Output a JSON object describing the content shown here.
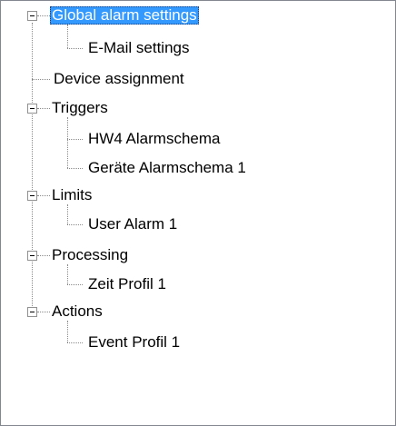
{
  "tree": {
    "nodes": [
      {
        "label": "Global alarm settings",
        "selected": true,
        "expanded": true,
        "children": [
          {
            "label": "E-Mail settings"
          }
        ]
      },
      {
        "label": "Device assignment"
      },
      {
        "label": "Triggers",
        "expanded": true,
        "children": [
          {
            "label": "HW4 Alarmschema"
          },
          {
            "label": "Geräte Alarmschema 1"
          }
        ]
      },
      {
        "label": "Limits",
        "expanded": true,
        "children": [
          {
            "label": "User Alarm 1"
          }
        ]
      },
      {
        "label": "Processing",
        "expanded": true,
        "children": [
          {
            "label": "Zeit Profil 1"
          }
        ]
      },
      {
        "label": "Actions",
        "expanded": true,
        "children": [
          {
            "label": "Event Profil 1"
          }
        ]
      }
    ]
  },
  "colors": {
    "selection": "#3399ff",
    "selection_text": "#ffffff",
    "connector": "#8a8a8a"
  }
}
